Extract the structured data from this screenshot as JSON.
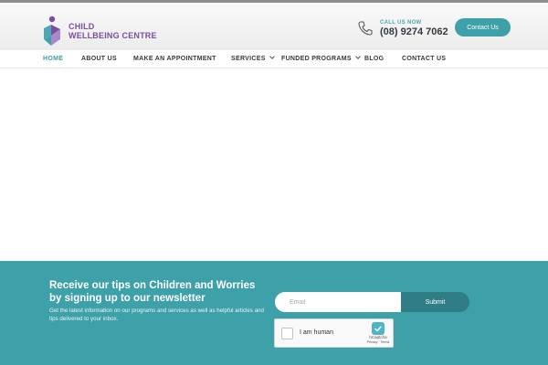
{
  "brand": {
    "line1": "CHILD",
    "line2": "WELLBEING CENTRE"
  },
  "header": {
    "call_caption": "CALL US NOW",
    "phone": "(08) 9274 7062",
    "contact_button": "Contact Us"
  },
  "nav": {
    "items": [
      {
        "label": "HOME",
        "active": true
      },
      {
        "label": "ABOUT US"
      },
      {
        "label": "MAKE AN APPOINTMENT"
      },
      {
        "label": "SERVICES",
        "dropdown": true
      },
      {
        "label": "FUNDED PROGRAMS",
        "dropdown": true
      },
      {
        "label": "BLOG"
      },
      {
        "label": "CONTACT US"
      }
    ]
  },
  "newsletter": {
    "title": "Receive our tips on Children and Worries by signing up to our newsletter",
    "description": "Get the latest information on our programs and services as well as helpful articles and tips delivered to your inbox.",
    "email_placeholder": "Email",
    "submit_label": "Submit"
  },
  "captcha": {
    "label": "I am human",
    "brand": "hCaptcha",
    "links": "Privacy · Terms"
  },
  "colors": {
    "teal": "#3ea1aa",
    "dark_teal": "#2f7d85",
    "purple": "#7a4f9f",
    "nav_text": "#333a40"
  }
}
